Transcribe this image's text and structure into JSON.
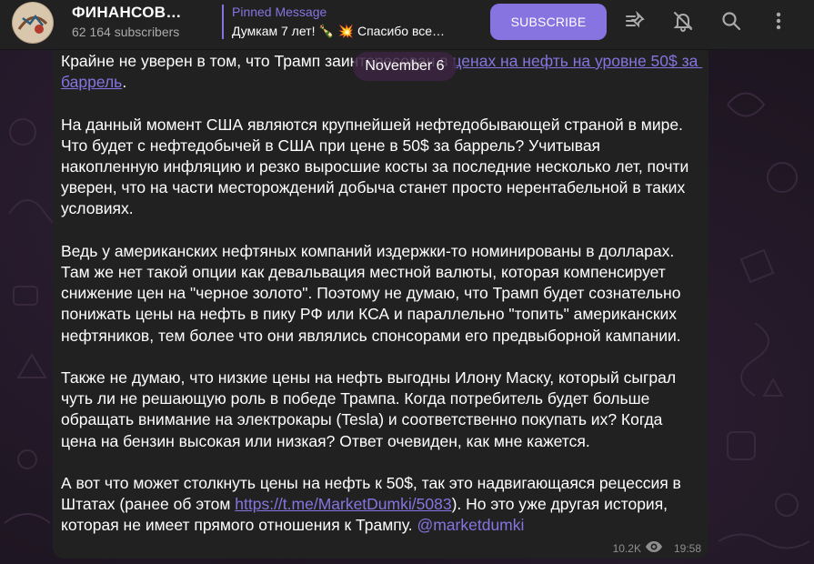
{
  "header": {
    "channel_title": "ФИНАНСОВ…",
    "subscribers": "62 164 subscribers",
    "pinned_title": "Pinned Message",
    "pinned_text": "Думкам 7 лет! 🍾 💥  Спасибо все…",
    "subscribe_label": "SUBSCRIBE",
    "icons": [
      "pin-list-icon",
      "bell-muted-icon",
      "search-icon",
      "more-vertical-icon"
    ]
  },
  "date_pill": "November 6",
  "message": {
    "p1_before": "Крайне не уверен в том, что Трамп заинтересован в ",
    "p1_link": "ценах на нефть на уровне 50$ за баррель",
    "p1_after": ".",
    "p2": "На данный момент США являются крупнейшей нефтедобывающей страной в мире. Что будет с нефтедобычей в США при цене в 50$ за баррель? Учитывая накопленную инфляцию и резко выросшие косты за последние несколько лет, почти уверен, что на части месторождений добыча станет просто нерентабельной в таких условиях.",
    "p3": "Ведь у американских нефтяных компаний издержки-то номинированы в долларах. Там же нет такой опции как девальвация местной валюты, которая компенсирует снижение цен на \"черное золото\". Поэтому не думаю, что Трамп будет сознательно понижать цены на нефть в пику РФ или КСА и параллельно \"топить\" американских нефтяников, тем более что они являлись спонсорами его предвыборной кампании.",
    "p4": "Также не думаю, что низкие цены на нефть выгодны Илону Маску, который сыграл чуть ли не решающую роль в победе Трампа. Когда потребитель будет больше обращать внимание на электрокары (Tesla) и соответственно покупать их? Когда цена на бензин высокая или низкая? Ответ очевиден, как мне кажется.",
    "p5_before": "А вот что может столкнуть цены на нефть к 50$, так это надвигающаяся рецессия в Штатах (ранее об этом ",
    "p5_link": "https://t.me/MarketDumki/5083",
    "p5_after": "). Но это уже другая история, которая не имеет прямого отношения к Трампу. ",
    "p5_mention": "@marketdumki",
    "views": "10.2K",
    "time": "19:58"
  },
  "colors": {
    "accent": "#8774e1",
    "header_bg": "#212121",
    "bubble_bg": "#212121"
  }
}
